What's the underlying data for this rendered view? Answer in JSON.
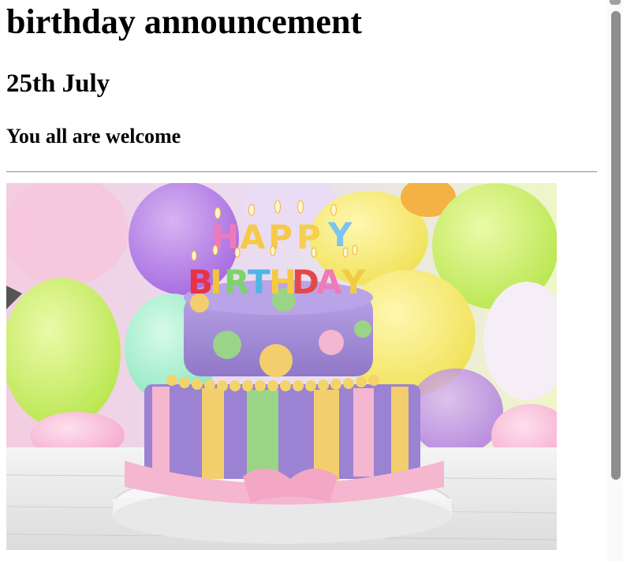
{
  "page": {
    "heading": "birthday announcement",
    "date": "25th July",
    "welcome": "You all are welcome"
  },
  "image": {
    "alt": "Birthday cake with HAPPY BIRTHDAY candles in front of colorful balloons",
    "candle_letters_top": "HAPPY",
    "candle_letters_bottom": "BIRTHDAY"
  },
  "colors": {
    "cake_purple": "#a88fd6",
    "ribbon_pink": "#f5b6cf",
    "stripe_yellow": "#f2cf6c",
    "stripe_green": "#9ad486"
  }
}
